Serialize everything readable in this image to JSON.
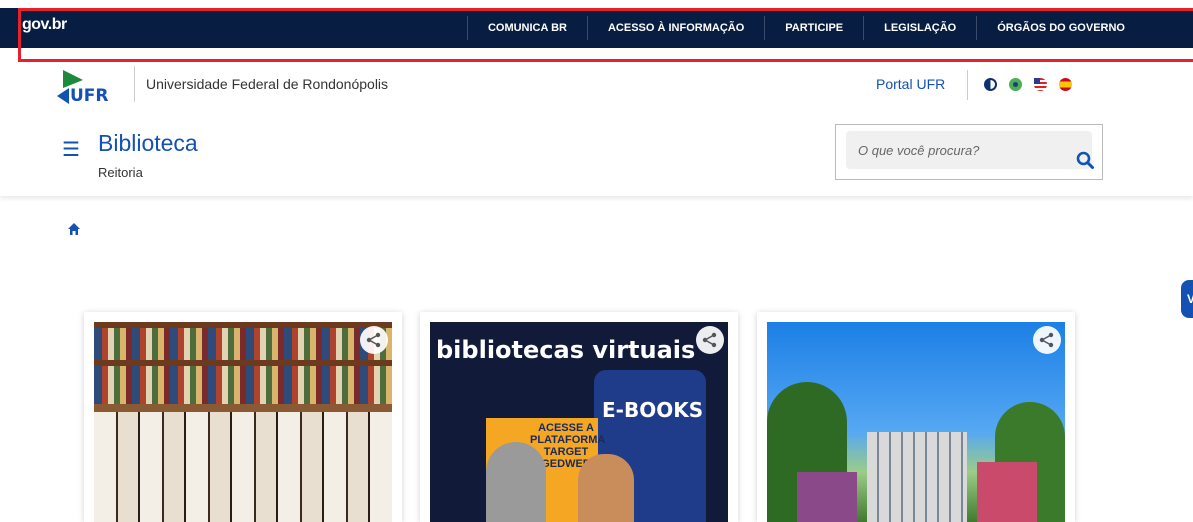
{
  "govbar": {
    "logo": "gov.br",
    "nav": [
      "COMUNICA BR",
      "ACESSO À INFORMAÇÃO",
      "PARTICIPE",
      "LEGISLAÇÃO",
      "ÓRGÃOS DO GOVERNO"
    ]
  },
  "header": {
    "logo_text": "UFR",
    "university_name": "Universidade Federal de Rondonópolis",
    "portal_link": "Portal UFR",
    "site_title": "Biblioteca",
    "site_subtitle": "Reitoria",
    "search_placeholder": "O que você procura?"
  },
  "cards": [
    {
      "icon": "share-icon"
    },
    {
      "title": "bibliotecas virtuais",
      "badge": "E-BOOKS",
      "promo": "ACESSE A PLATAFORMA TARGET GEDWEB",
      "icon": "share-icon"
    },
    {
      "icon": "share-icon"
    }
  ],
  "colors": {
    "govbar": "#071d41",
    "primary": "#1351b4",
    "highlight": "#e5222b"
  }
}
